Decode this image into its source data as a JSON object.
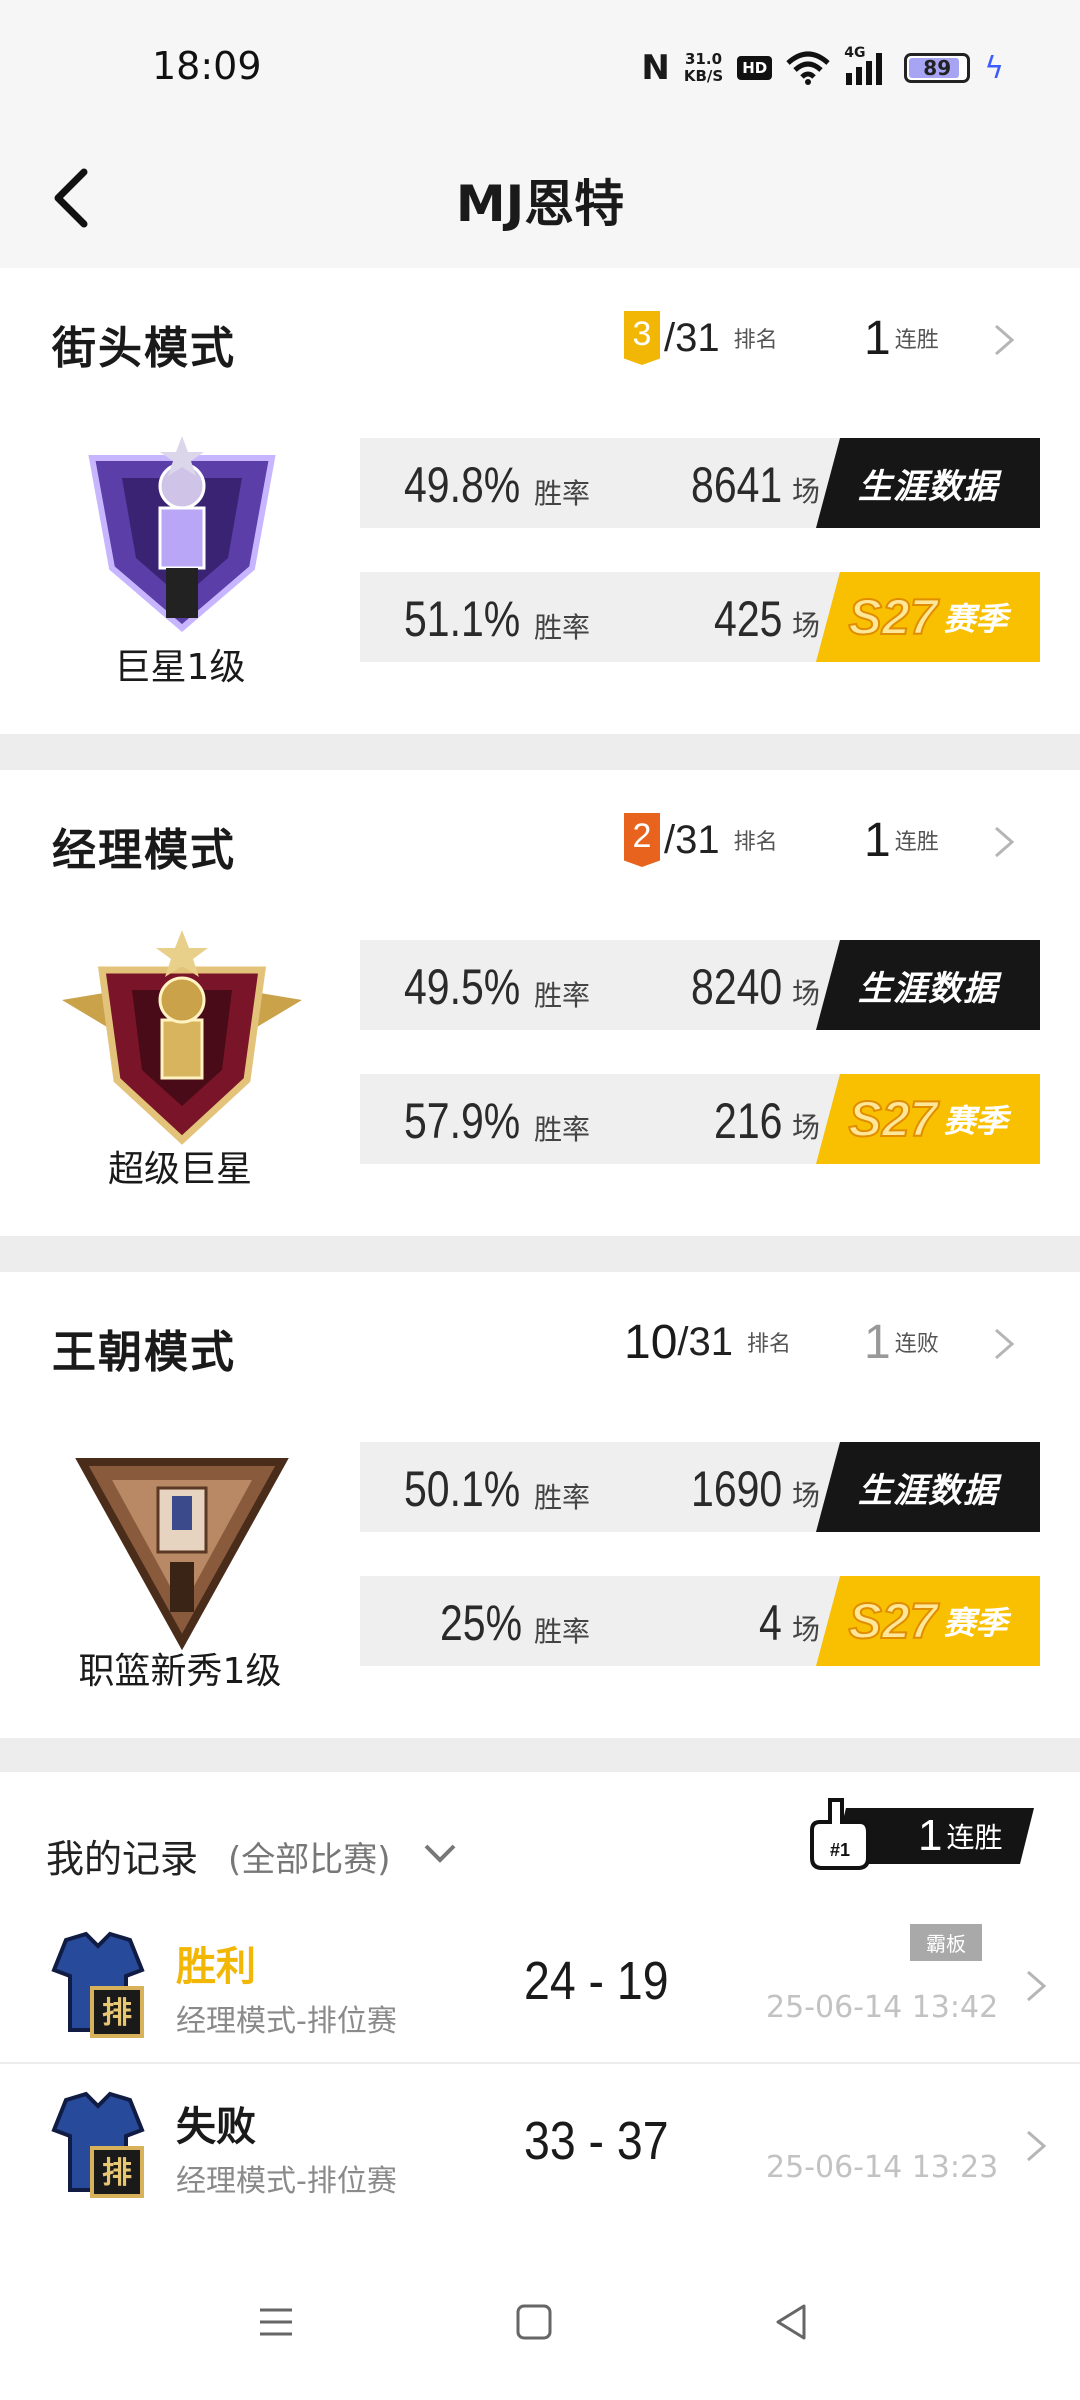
{
  "status_bar": {
    "time": "18:09",
    "nfc": "N",
    "net_speed_value": "31.0",
    "net_speed_unit": "KB/S",
    "hd": "HD",
    "network": "4G",
    "battery": "89",
    "battery_level": 0.89
  },
  "header": {
    "title": "MJ恩特"
  },
  "modes": [
    {
      "title": "街头模式",
      "rank": "3",
      "rank_style": "gold",
      "rank_total": "/31",
      "rank_label": "排名",
      "streak": "1",
      "streak_label": "连胜",
      "badge_caption": "巨星1级",
      "career": {
        "win_rate": "49.8%",
        "win_rate_label": "胜率",
        "games": "8641",
        "games_label": "场",
        "tag": "生涯数据"
      },
      "season": {
        "win_rate": "51.1%",
        "win_rate_label": "胜率",
        "games": "425",
        "games_label": "场",
        "code": "S27",
        "word": "赛季"
      }
    },
    {
      "title": "经理模式",
      "rank": "2",
      "rank_style": "orange",
      "rank_total": "/31",
      "rank_label": "排名",
      "streak": "1",
      "streak_label": "连胜",
      "badge_caption": "超级巨星",
      "career": {
        "win_rate": "49.5%",
        "win_rate_label": "胜率",
        "games": "8240",
        "games_label": "场",
        "tag": "生涯数据"
      },
      "season": {
        "win_rate": "57.9%",
        "win_rate_label": "胜率",
        "games": "216",
        "games_label": "场",
        "code": "S27",
        "word": "赛季"
      }
    },
    {
      "title": "王朝模式",
      "rank": "10",
      "rank_style": "plain",
      "rank_total": "/31",
      "rank_label": "排名",
      "streak": "1",
      "streak_label": "连败",
      "badge_caption": "职篮新秀1级",
      "career": {
        "win_rate": "50.1%",
        "win_rate_label": "胜率",
        "games": "1690",
        "games_label": "场",
        "tag": "生涯数据"
      },
      "season": {
        "win_rate": "25%",
        "win_rate_label": "胜率",
        "games": "4",
        "games_label": "场",
        "code": "S27",
        "word": "赛季"
      }
    }
  ],
  "records": {
    "title": "我的记录",
    "filter": "(全部比赛)",
    "streak_number": "1",
    "streak_label": "连胜",
    "foam_finger_text": "#1",
    "matches": [
      {
        "result": "胜利",
        "result_color": "#f2b705",
        "mode": "经理模式-排位赛",
        "score": "24 - 19",
        "tag": "霸板",
        "time": "25-06-14 13:42",
        "icon_text": "排"
      },
      {
        "result": "失败",
        "result_color": "#1a1a1a",
        "mode": "经理模式-排位赛",
        "score": "33 - 37",
        "tag": "",
        "time": "25-06-14 13:23",
        "icon_text": "排"
      }
    ]
  },
  "colors": {
    "gold": "#f2b705",
    "orange": "#e8641e",
    "career_tag_bg": "#161616",
    "season_tag_bg": "#f8c000"
  },
  "nav": {
    "menu": "menu-icon",
    "home": "home-icon",
    "back": "back-icon"
  }
}
